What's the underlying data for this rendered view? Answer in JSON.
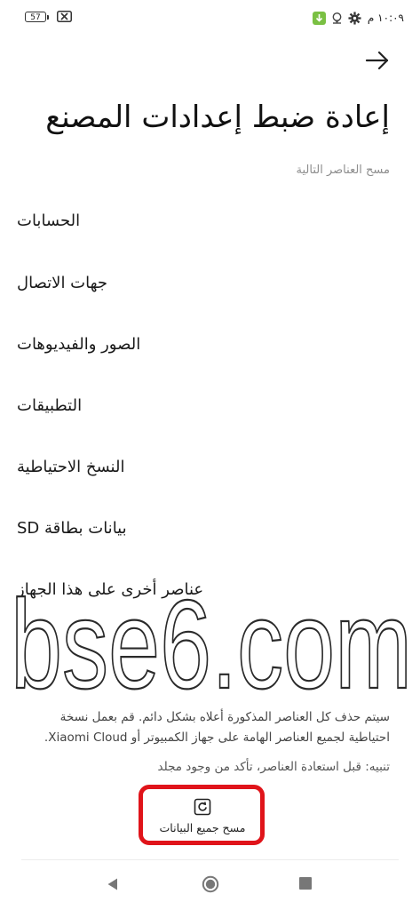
{
  "status_bar": {
    "battery": "57",
    "time": "١٠:٠٩ م",
    "icons": [
      "no-sim-icon",
      "download-icon",
      "location-icon",
      "gear-icon"
    ]
  },
  "header": {
    "back_icon": "arrow-right-icon",
    "title": "إعادة ضبط إعدادات المصنع"
  },
  "section_label": "مسح العناصر التالية",
  "items": [
    "الحسابات",
    "جهات الاتصال",
    "الصور والفيديوهات",
    "التطبيقات",
    "النسخ الاحتياطية",
    "بيانات بطاقة SD",
    "عناصر أخرى على هذا الجهاز"
  ],
  "watermark": "bse6.com",
  "warning": "سيتم حذف كل العناصر المذكورة أعلاه بشكل دائم. قم بعمل نسخة احتياطية لجميع العناصر الهامة على جهاز الكمبيوتر أو Xiaomi Cloud.",
  "note": "تنبيه: قبل استعادة العناصر، تأكد من وجود مجلد",
  "wipe_button": {
    "label": "مسح جميع البيانات",
    "icon": "wipe-data-icon"
  },
  "colors": {
    "highlight": "#e0141a",
    "download_badge": "#7ac043",
    "secondary_text": "#8e8e8e"
  },
  "nav_bar": {
    "icons": [
      "nav-back-icon",
      "nav-home-icon",
      "nav-recents-icon"
    ]
  }
}
